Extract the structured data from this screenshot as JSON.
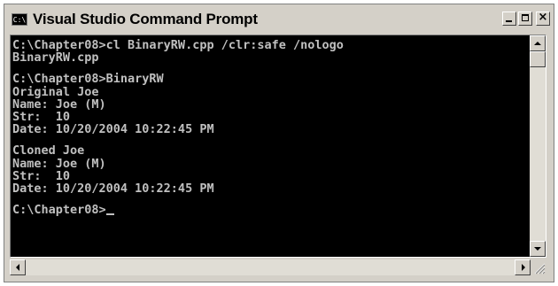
{
  "window": {
    "title": "Visual Studio Command Prompt",
    "icon": "C:\\",
    "icon_name": "console-icon"
  },
  "console": {
    "lines": [
      "C:\\Chapter08>cl BinaryRW.cpp /clr:safe /nologo",
      "BinaryRW.cpp",
      "",
      "C:\\Chapter08>BinaryRW",
      "Original Joe",
      "Name: Joe (M)",
      "Str:  10",
      "Date: 10/20/2004 10:22:45 PM",
      "",
      "Cloned Joe",
      "Name: Joe (M)",
      "Str:  10",
      "Date: 10/20/2004 10:22:45 PM",
      "",
      "C:\\Chapter08>"
    ]
  },
  "colors": {
    "background": "#000000",
    "text": "#c0c0c0",
    "chrome": "#d4d0c8"
  }
}
